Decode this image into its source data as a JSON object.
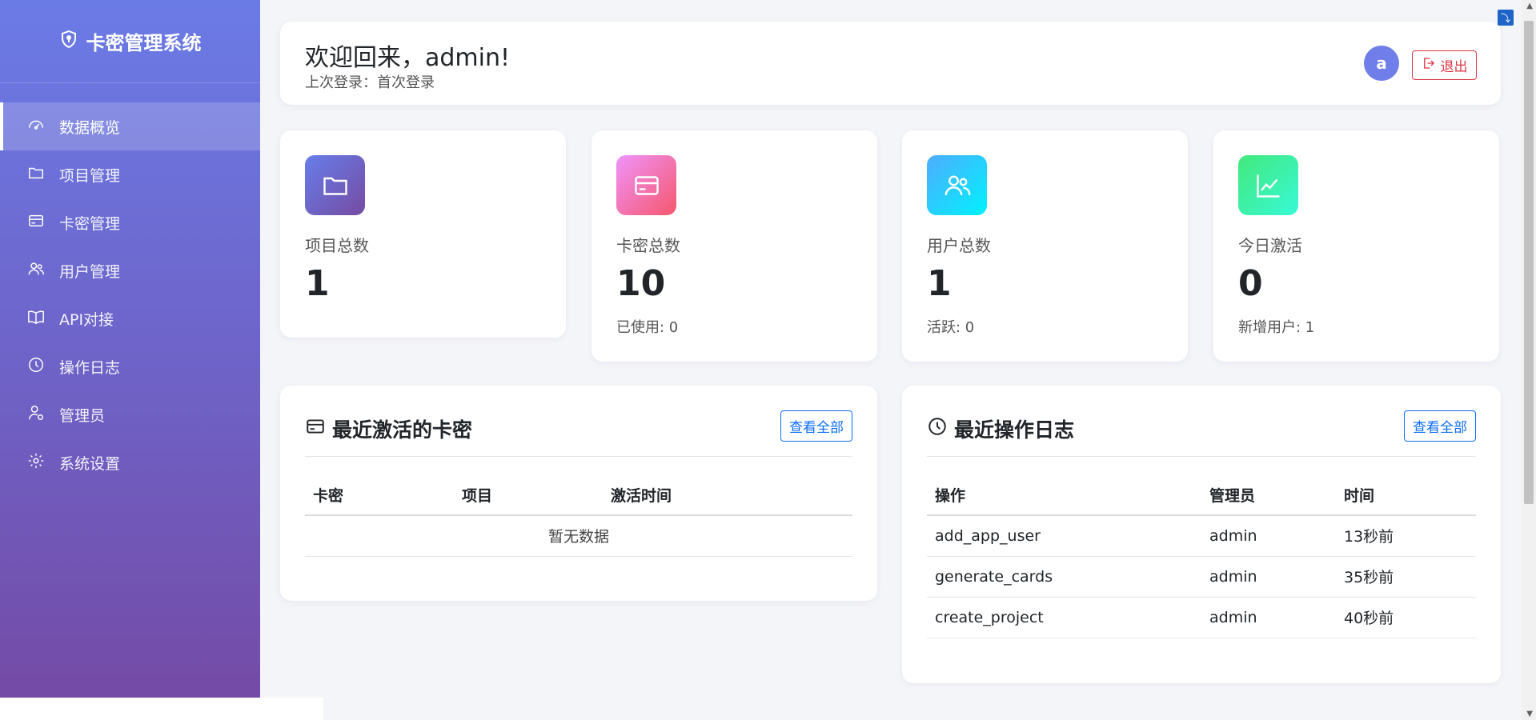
{
  "sidebar": {
    "brand": "卡密管理系统",
    "items": [
      {
        "label": "数据概览",
        "icon": "dashboard-icon",
        "active": true
      },
      {
        "label": "项目管理",
        "icon": "folder-icon"
      },
      {
        "label": "卡密管理",
        "icon": "card-icon"
      },
      {
        "label": "用户管理",
        "icon": "users-icon"
      },
      {
        "label": "API对接",
        "icon": "book-icon"
      },
      {
        "label": "操作日志",
        "icon": "clock-icon"
      },
      {
        "label": "管理员",
        "icon": "admin-icon"
      },
      {
        "label": "系统设置",
        "icon": "gear-icon"
      }
    ]
  },
  "header": {
    "welcome": "欢迎回来，admin!",
    "last_login": "上次登录：首次登录",
    "avatar_letter": "a",
    "logout_label": "退出"
  },
  "stats": [
    {
      "label": "项目总数",
      "value": "1",
      "sub": "",
      "icon": "folder-icon",
      "gradient": [
        "#667eea",
        "#764ba2"
      ]
    },
    {
      "label": "卡密总数",
      "value": "10",
      "sub": "已使用: 0",
      "icon": "card-icon",
      "gradient": [
        "#f093fb",
        "#f5576c"
      ]
    },
    {
      "label": "用户总数",
      "value": "1",
      "sub": "活跃: 0",
      "icon": "users-icon",
      "gradient": [
        "#4facfe",
        "#00f2fe"
      ]
    },
    {
      "label": "今日激活",
      "value": "0",
      "sub": "新增用户: 1",
      "icon": "chart-icon",
      "gradient": [
        "#43e97b",
        "#38f9d7"
      ]
    }
  ],
  "recent_cards": {
    "title": "最近激活的卡密",
    "view_all": "查看全部",
    "columns": [
      "卡密",
      "项目",
      "激活时间"
    ],
    "empty_text": "暂无数据"
  },
  "recent_logs": {
    "title": "最近操作日志",
    "view_all": "查看全部",
    "columns": [
      "操作",
      "管理员",
      "时间"
    ],
    "rows": [
      [
        "add_app_user",
        "admin",
        "13秒前"
      ],
      [
        "generate_cards",
        "admin",
        "35秒前"
      ],
      [
        "create_project",
        "admin",
        "40秒前"
      ]
    ]
  }
}
